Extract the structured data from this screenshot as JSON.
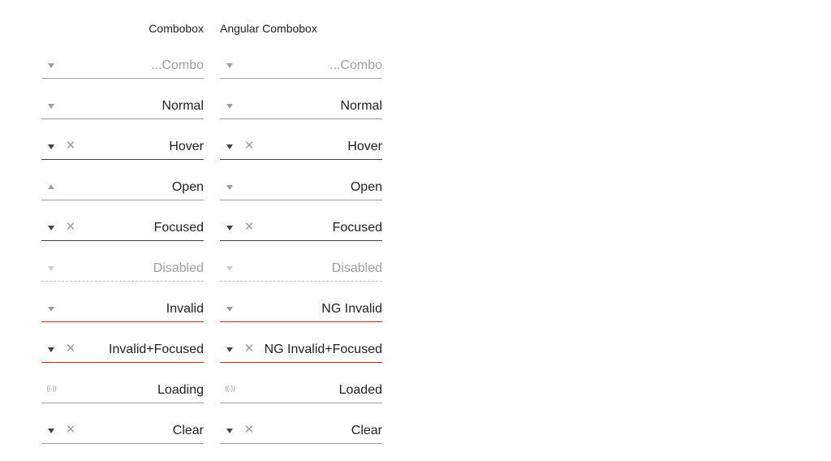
{
  "columns": [
    {
      "header": "Combobox",
      "rows": [
        {
          "value": "...Combo",
          "state": "placeholder",
          "arrow": "down",
          "clear": false,
          "spinner": false
        },
        {
          "value": "Normal",
          "state": "normal",
          "arrow": "down",
          "clear": false,
          "spinner": false
        },
        {
          "value": "Hover",
          "state": "hover",
          "arrow": "down",
          "clear": true,
          "spinner": false
        },
        {
          "value": "Open",
          "state": "open",
          "arrow": "up",
          "clear": false,
          "spinner": false
        },
        {
          "value": "Focused",
          "state": "focused",
          "arrow": "down",
          "clear": true,
          "spinner": false
        },
        {
          "value": "Disabled",
          "state": "disabled",
          "arrow": "down",
          "clear": false,
          "spinner": false
        },
        {
          "value": "Invalid",
          "state": "invalid",
          "arrow": "down",
          "clear": false,
          "spinner": false
        },
        {
          "value": "Invalid+Focused",
          "state": "invalid-focused",
          "arrow": "down",
          "clear": true,
          "spinner": false
        },
        {
          "value": "Loading",
          "state": "loading",
          "arrow": "none",
          "clear": false,
          "spinner": true
        },
        {
          "value": "Clear",
          "state": "clear",
          "arrow": "down",
          "clear": true,
          "spinner": false
        }
      ]
    },
    {
      "header": "Angular Combobox",
      "rows": [
        {
          "value": "...Combo",
          "state": "placeholder",
          "arrow": "down",
          "clear": false,
          "spinner": false
        },
        {
          "value": "Normal",
          "state": "normal",
          "arrow": "down",
          "clear": false,
          "spinner": false
        },
        {
          "value": "Hover",
          "state": "hover",
          "arrow": "down",
          "clear": true,
          "spinner": false
        },
        {
          "value": "Open",
          "state": "open",
          "arrow": "down",
          "clear": false,
          "spinner": false
        },
        {
          "value": "Focused",
          "state": "focused",
          "arrow": "down",
          "clear": true,
          "spinner": false
        },
        {
          "value": "Disabled",
          "state": "disabled",
          "arrow": "down",
          "clear": false,
          "spinner": false
        },
        {
          "value": "NG Invalid",
          "state": "invalid",
          "arrow": "down",
          "clear": false,
          "spinner": false
        },
        {
          "value": "NG Invalid+Focused",
          "state": "invalid-focused",
          "arrow": "down",
          "clear": true,
          "spinner": false
        },
        {
          "value": "Loaded",
          "state": "loaded",
          "arrow": "none",
          "clear": false,
          "spinner": true
        },
        {
          "value": "Clear",
          "state": "clear",
          "arrow": "down",
          "clear": true,
          "spinner": false
        }
      ]
    }
  ],
  "icons": {
    "arrow": "chevron-down-icon",
    "clear": "close-icon",
    "clear_glyph": "✕",
    "spinner": "loading-spinner-icon",
    "spinner_glyph": "((·))"
  },
  "colors": {
    "underline": "#9e9e9e",
    "underline_active": "#424242",
    "underline_invalid": "#c62828",
    "text": "#212121",
    "muted": "#9e9e9e"
  }
}
